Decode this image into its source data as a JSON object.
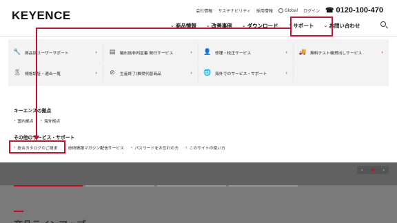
{
  "header": {
    "logo_text": "KEYENCE",
    "util_links": [
      "会社情報",
      "サステナビリティ",
      "採用情報"
    ],
    "global_label": "Global",
    "login_label": "ログイン",
    "phone": "0120-100-470"
  },
  "mainnav": [
    {
      "label": "商品情報"
    },
    {
      "label": "改善事例"
    },
    {
      "label": "ダウンロード"
    },
    {
      "label": "サポート"
    },
    {
      "label": "お問い合わせ"
    }
  ],
  "mega": {
    "grid": [
      {
        "label": "商品別ユーザーサポート",
        "icon": "wrench-icon"
      },
      {
        "label": "輸出該非判定書 発行サービス",
        "icon": "document-icon"
      },
      {
        "label": "修理・校正サービス",
        "icon": "repair-person-icon"
      },
      {
        "label": "無料テスト機貸出しサービス",
        "icon": "truck-icon"
      },
      {
        "label": "規格認証・適合一覧",
        "icon": "ribbon-icon"
      },
      {
        "label": "生産終了/推奨代替商品",
        "icon": "prohibited-icon"
      },
      {
        "label": "海外でのサービス・サポート",
        "icon": "globe-icon"
      }
    ],
    "bases_title": "キーエンスの拠点",
    "bases_links": [
      "国内拠点",
      "海外拠点"
    ],
    "other_title": "その他のサービス・サポート",
    "other_links": [
      "総合カタログのご請求",
      "技術情報マガジン配信サービス",
      "パスワードをお忘れの方",
      "このサイトの使い方"
    ]
  },
  "band": {
    "pager_mid": "II",
    "title": "商品ラインアップ"
  },
  "colors": {
    "accent": "#d6001c",
    "annotation": "#c8102e"
  }
}
